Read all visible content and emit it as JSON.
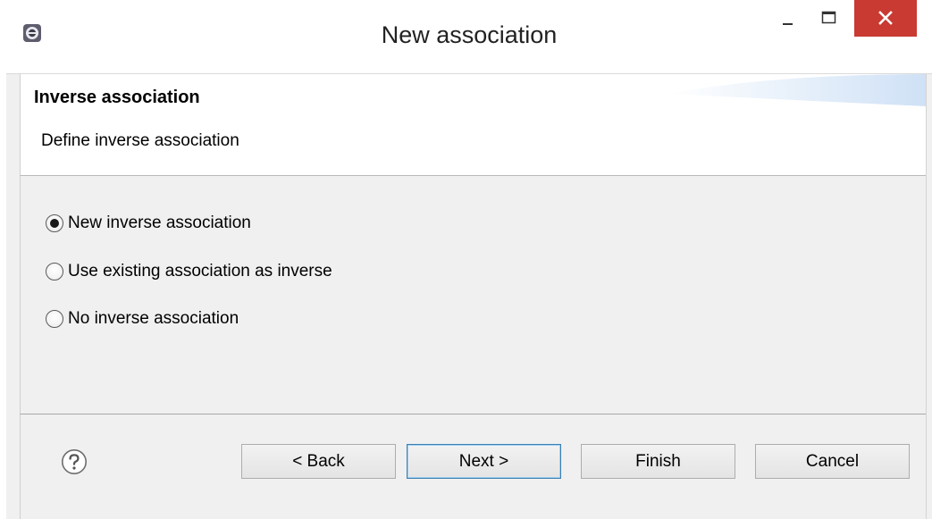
{
  "window": {
    "title": "New association",
    "controls": [
      "minimize-icon",
      "maximize-icon",
      "close-icon"
    ],
    "app_icon": "eclipse-icon"
  },
  "header": {
    "title": "Inverse association",
    "description": "Define inverse association"
  },
  "options": {
    "selected_index": 0,
    "items": [
      {
        "label": "New inverse association",
        "checked": true
      },
      {
        "label": "Use existing association as inverse",
        "checked": false
      },
      {
        "label": "No inverse association",
        "checked": false
      }
    ]
  },
  "footer": {
    "help_icon": "help-icon",
    "buttons": {
      "back": "< Back",
      "next": "Next >",
      "finish": "Finish",
      "cancel": "Cancel"
    },
    "default_button": "next"
  },
  "colors": {
    "close_button": "#c93a32",
    "default_button_border": "#3c7fb1",
    "dialog_background": "#f0f0f0"
  }
}
